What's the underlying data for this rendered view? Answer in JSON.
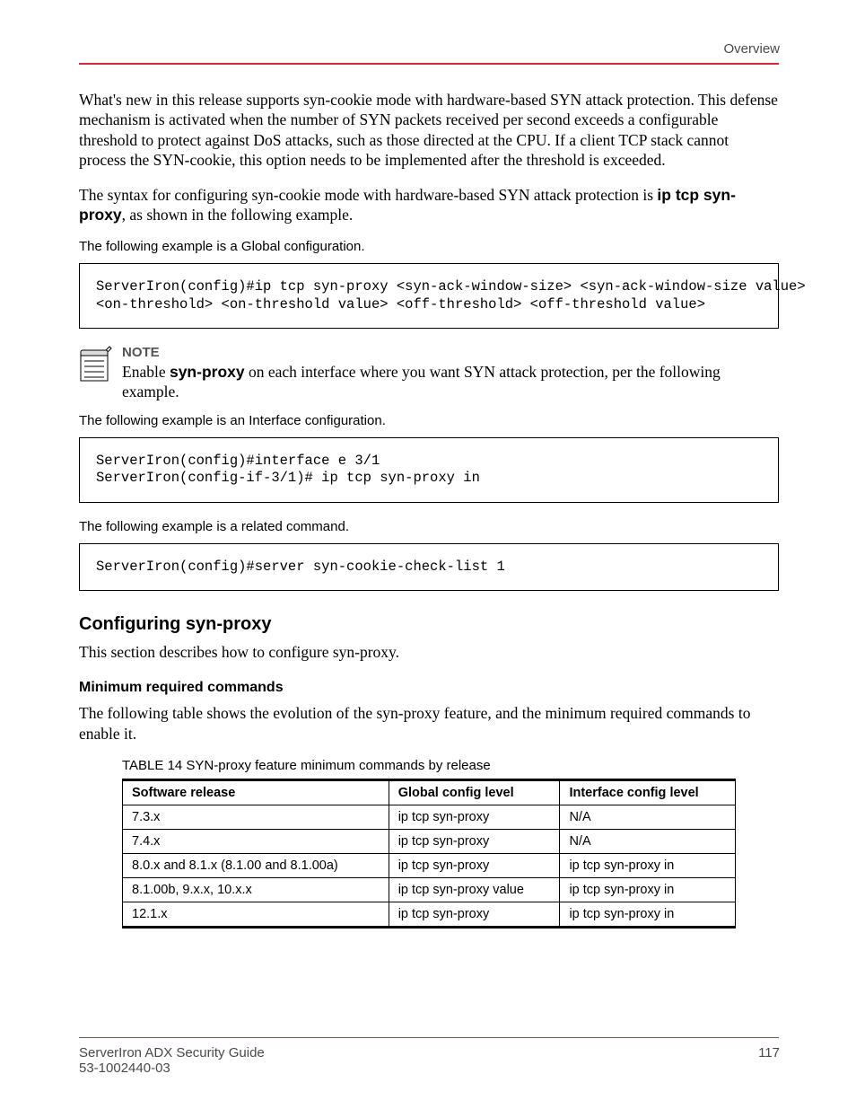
{
  "header": {
    "right": "Overview"
  },
  "footer": {
    "left": "ServerIron ADX Security Guide",
    "right": "117",
    "sub": "53-1002440-03"
  },
  "intro": {
    "p1": "What's new in this release supports syn-cookie mode with hardware-based SYN attack protection. This defense mechanism is activated when the number of SYN packets received per second exceeds a configurable threshold to protect against DoS attacks, such as those directed at the CPU. If a client TCP stack cannot process the SYN-cookie, this option needs to be implemented after the threshold is exceeded.",
    "p2_prefix": "The syntax for configuring syn-cookie mode with hardware-based SYN attack protection is ",
    "p2_bold": "ip tcp syn-proxy",
    "p2_suffix": ", as shown in the following example.",
    "example_label": "The following example is a Global configuration.",
    "example": "ServerIron(config)#ip tcp syn-proxy <syn-ack-window-size> <syn-ack-window-size value>\n<on-threshold> <on-threshold value> <off-threshold> <off-threshold value>"
  },
  "note": {
    "label": "NOTE",
    "text_prefix": "Enable ",
    "text_bold": "syn-proxy",
    "text_suffix": " on each interface where you want SYN attack protection, per the following example."
  },
  "interface_example_label": "The following example is an Interface configuration.",
  "interface_example": "ServerIron(config)#interface e 3/1\nServerIron(config-if-3/1)# ip tcp syn-proxy in",
  "related_label": "The following example is a related command.",
  "related_example": "ServerIron(config)#server syn-cookie-check-list 1",
  "section": {
    "title": "Configuring syn-proxy",
    "p1": "This section describes how to configure syn-proxy.",
    "sub_title": "Minimum required commands",
    "p2": "The following table shows the evolution of the syn-proxy feature, and the minimum required commands to enable it.",
    "table_label": "TABLE 14     SYN-proxy feature minimum commands by release"
  },
  "chart_data": {
    "type": "table",
    "columns": [
      "Software release",
      "Global config level",
      "Interface config level"
    ],
    "rows": [
      [
        "7.3.x",
        "ip tcp syn-proxy",
        "N/A"
      ],
      [
        "7.4.x",
        "ip tcp syn-proxy",
        "N/A"
      ],
      [
        "8.0.x and 8.1.x (8.1.00 and 8.1.00a)",
        "ip tcp syn-proxy",
        "ip tcp syn-proxy in"
      ],
      [
        "8.1.00b, 9.x.x, 10.x.x",
        "ip tcp syn-proxy value",
        "ip tcp syn-proxy in"
      ],
      [
        "12.1.x",
        "ip tcp syn-proxy",
        "ip tcp syn-proxy in"
      ]
    ]
  }
}
